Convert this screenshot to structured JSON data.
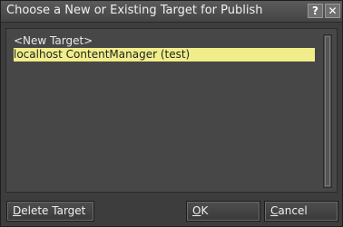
{
  "dialog": {
    "title": "Choose a New or Existing Target for Publish",
    "help_glyph": "?",
    "close_glyph": "✕"
  },
  "targets": {
    "items": [
      {
        "label": "<New Target>",
        "selected": false
      },
      {
        "label": "localhost ContentManager (test)",
        "selected": true
      }
    ]
  },
  "buttons": {
    "delete": {
      "mnemonic": "D",
      "rest": "elete Target"
    },
    "ok": {
      "mnemonic": "O",
      "rest": "K"
    },
    "cancel": {
      "mnemonic": "C",
      "rest": "ancel"
    }
  },
  "colors": {
    "selection_highlight": "#f1ee8a",
    "dialog_bg": "#3d3d3d"
  }
}
